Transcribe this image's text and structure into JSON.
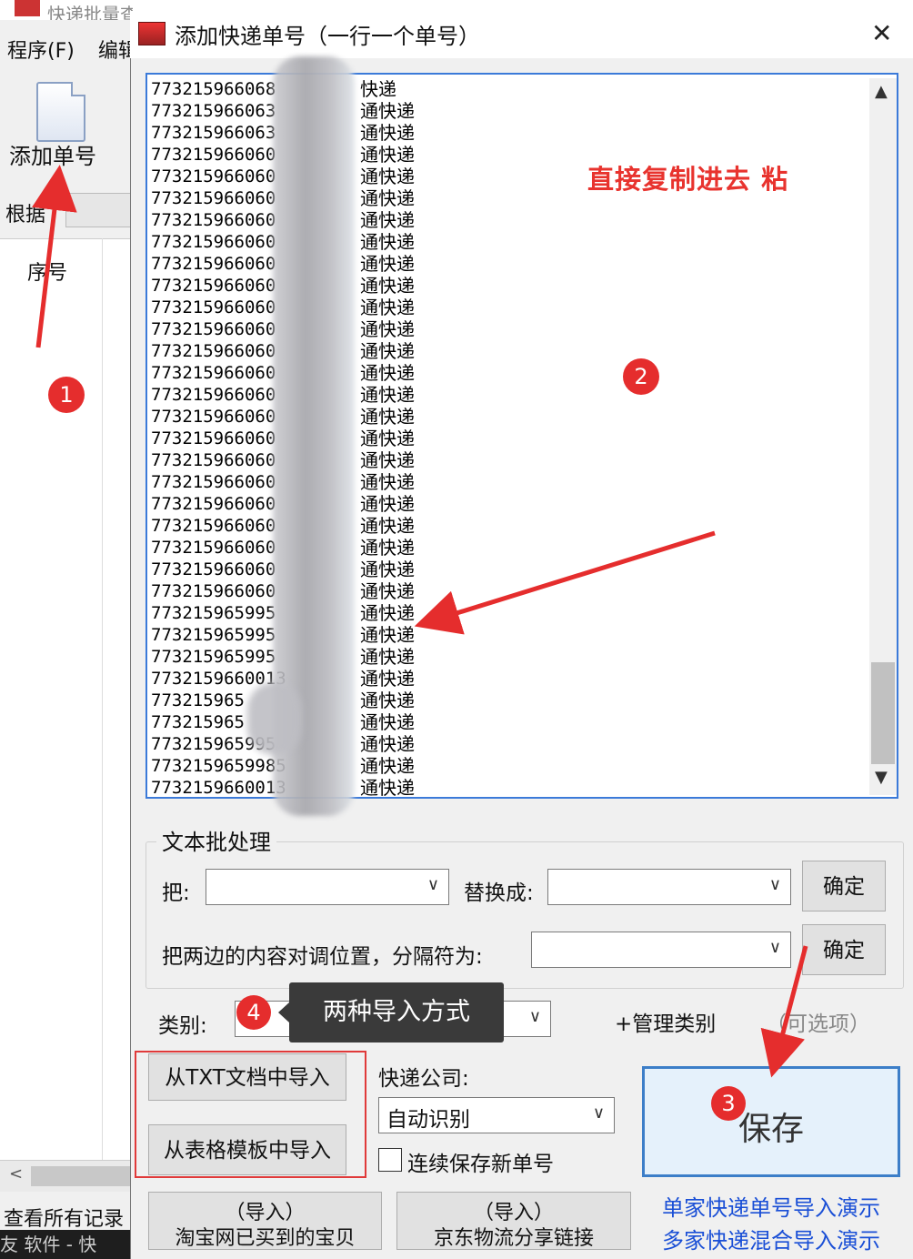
{
  "background_window": {
    "title": "快递批量查询高手  [abckk]",
    "menu": [
      "程序(F)",
      "编辑"
    ],
    "add_label": "添加单号",
    "basis_label": "根据",
    "seq_header": "序号",
    "view_all": "查看所有记录",
    "taskbar": "友  软件 - 快"
  },
  "dialog": {
    "title": "添加快递单号（一行一个单号）",
    "close_glyph": "✕",
    "tracking_lines": [
      {
        "number": "773215966068",
        "courier": "快递"
      },
      {
        "number": "773215966063",
        "courier": "通快递"
      },
      {
        "number": "773215966063",
        "courier": "通快递"
      },
      {
        "number": "773215966060",
        "courier": "通快递"
      },
      {
        "number": "773215966060",
        "courier": "通快递"
      },
      {
        "number": "773215966060",
        "courier": "通快递"
      },
      {
        "number": "773215966060",
        "courier": "通快递"
      },
      {
        "number": "773215966060",
        "courier": "通快递"
      },
      {
        "number": "773215966060",
        "courier": "通快递"
      },
      {
        "number": "773215966060",
        "courier": "通快递"
      },
      {
        "number": "773215966060",
        "courier": "通快递"
      },
      {
        "number": "773215966060",
        "courier": "通快递"
      },
      {
        "number": "773215966060",
        "courier": "通快递"
      },
      {
        "number": "773215966060",
        "courier": "通快递"
      },
      {
        "number": "773215966060",
        "courier": "通快递"
      },
      {
        "number": "773215966060",
        "courier": "通快递"
      },
      {
        "number": "773215966060",
        "courier": "通快递"
      },
      {
        "number": "773215966060",
        "courier": "通快递"
      },
      {
        "number": "773215966060",
        "courier": "通快递"
      },
      {
        "number": "773215966060",
        "courier": "通快递"
      },
      {
        "number": "773215966060",
        "courier": "通快递"
      },
      {
        "number": "773215966060",
        "courier": "通快递"
      },
      {
        "number": "773215966060",
        "courier": "通快递"
      },
      {
        "number": "773215966060",
        "courier": "通快递"
      },
      {
        "number": "773215965995",
        "courier": "通快递"
      },
      {
        "number": "773215965995",
        "courier": "通快递"
      },
      {
        "number": "773215965995",
        "courier": "通快递"
      },
      {
        "number": "7732159660013",
        "courier": "通快递"
      },
      {
        "number": "773215965",
        "courier": "通快递"
      },
      {
        "number": "773215965",
        "courier": "通快递"
      },
      {
        "number": "773215965995",
        "courier": "通快递"
      },
      {
        "number": "7732159659985",
        "courier": "通快递"
      },
      {
        "number": "7732159660013",
        "courier": "通快递"
      }
    ],
    "batch": {
      "group_title": "文本批处理",
      "from_label": "把:",
      "replace_label": "替换成:",
      "ok_label": "确定",
      "swap_label": "把两边的内容对调位置，分隔符为:",
      "ok2_label": "确定"
    },
    "category_label": "类别:",
    "manage_category": "+管理类别",
    "optional": "（可选项）",
    "import_txt": "从TXT文档中导入",
    "import_template": "从表格模板中导入",
    "company_label": "快递公司:",
    "company_value": "自动识别",
    "continuous_save": "连续保存新单号",
    "continuous_checked": false,
    "save_label": "保存",
    "demo_single": "单家快递单号导入演示",
    "demo_multi": "多家快递混合导入演示",
    "taobao": {
      "line1": "（导入）",
      "line2": "淘宝网已买到的宝贝"
    },
    "jd": {
      "line1": "（导入）",
      "line2": "京东物流分享链接"
    }
  },
  "annotations": {
    "paste_note": "直接复制进去 粘",
    "tooltip": "两种导入方式",
    "badges": [
      "1",
      "2",
      "3",
      "4"
    ]
  },
  "colors": {
    "annotation_red": "#e52d2d",
    "accent_blue": "#3b7ad9",
    "link_blue": "#1a4fd6"
  }
}
